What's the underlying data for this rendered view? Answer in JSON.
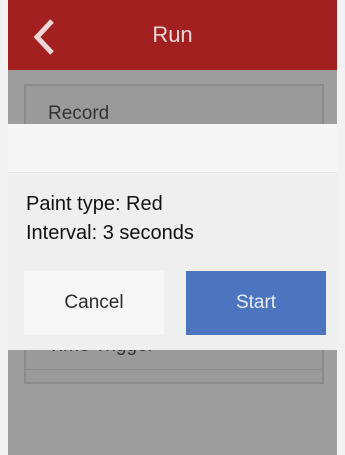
{
  "header": {
    "title": "Run",
    "back_icon": "chevron-left-icon",
    "color": "#a32020"
  },
  "list": {
    "items": [
      {
        "label": "Record"
      },
      {
        "label": "Time Trigger"
      }
    ]
  },
  "dialog": {
    "message_line1": "Paint type: Red",
    "message_line2": "Interval: 3 seconds",
    "cancel_label": "Cancel",
    "start_label": "Start",
    "start_color": "#4c74bf"
  }
}
